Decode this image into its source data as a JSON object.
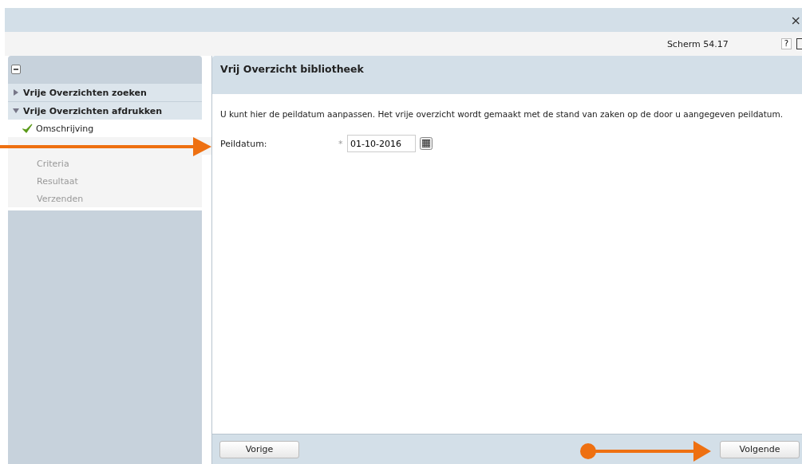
{
  "top_bar": {
    "close": "×"
  },
  "header": {
    "screen_code": "Scherm 54.17",
    "help": "?"
  },
  "sidebar": {
    "sections": [
      {
        "label": "Vrije Overzichten zoeken",
        "expanded": false
      },
      {
        "label": "Vrije Overzichten afdrukken",
        "expanded": true,
        "children": [
          {
            "label": "Omschrijving",
            "checked": true,
            "disabled": false,
            "selected": true
          },
          {
            "disabled": true,
            "selected": false
          },
          {
            "label": "Criteria",
            "checked": false,
            "disabled": true,
            "selected": false
          },
          {
            "label": "Resultaat",
            "checked": false,
            "disabled": true,
            "selected": false
          },
          {
            "label": "Verzenden",
            "checked": false,
            "disabled": true,
            "selected": false
          }
        ]
      }
    ]
  },
  "panel": {
    "title": "Vrij Overzicht bibliotheek",
    "intro": "U kunt hier de peildatum aanpassen. Het vrije overzicht wordt gemaakt met de stand van zaken op de door u aangegeven peildatum.",
    "field": {
      "label": "Peildatum:",
      "required_mark": "*",
      "value": "01-10-2016"
    },
    "buttons": [
      {
        "label": "Vorige",
        "kind": "back"
      },
      {
        "label": "Volgende",
        "kind": "next"
      }
    ]
  }
}
